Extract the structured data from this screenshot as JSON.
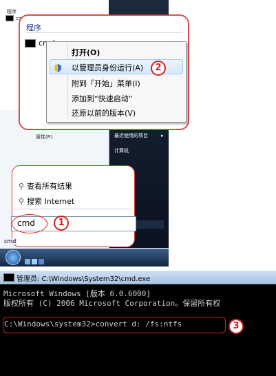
{
  "start_menu": {
    "top_label": "程序",
    "top_item": "cmd",
    "properties": "属性(R)",
    "right_items": [
      "最近使用的项目",
      "计算机"
    ]
  },
  "popup": {
    "header": "程序",
    "program": "cmd",
    "context_menu": [
      {
        "label": "打开(O)",
        "bold": true
      },
      {
        "label": "以管理员身份运行(A)"
      },
      {
        "label": "附到「开始」菜单(I)"
      },
      {
        "label": "添加到“快速启动”"
      },
      {
        "label": "还原以前的版本(V)"
      }
    ],
    "callout": "2"
  },
  "search": {
    "see_all": "查看所有结果",
    "search_internet": "搜索 Internet",
    "query": "cmd",
    "callout": "1"
  },
  "taskbar": {
    "start_label": "cmd"
  },
  "cmd": {
    "title": "管理员: C:\\Windows\\System32\\cmd.exe",
    "lines": [
      "Microsoft Windows [版本 6.0.6000]",
      "版权所有 (C) 2006 Microsoft Corporation。保留所有权",
      "",
      "C:\\Windows\\system32>convert d: /fs:ntfs"
    ],
    "callout": "3"
  },
  "colors": {
    "accent_red": "#d42121",
    "menu_blue": "#1e3a8a"
  }
}
